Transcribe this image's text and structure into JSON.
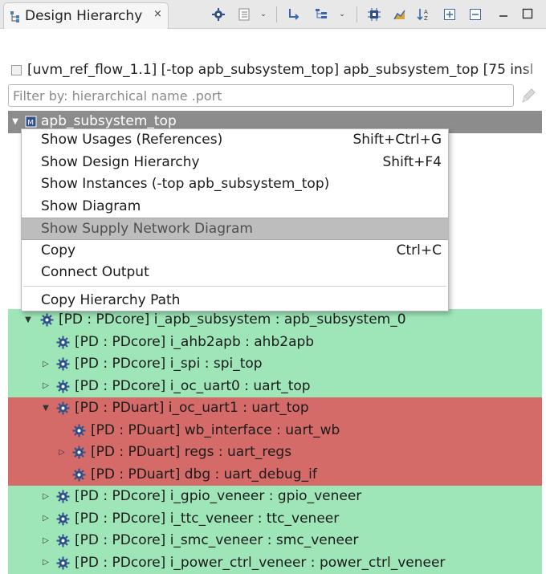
{
  "tab": {
    "title": "Design Hierarchy",
    "close_icon": "×"
  },
  "scope": {
    "text": "[uvm_ref_flow_1.1] [-top apb_subsystem_top] apb_subsystem_top [75 insl"
  },
  "filter": {
    "placeholder": "Filter by: hierarchical name .port",
    "value": ""
  },
  "tree": {
    "root": {
      "label": "apb_subsystem_top",
      "expanded": true,
      "selected": true
    },
    "rows": [
      {
        "label": "[PD : PDcore] i_apb_subsystem : apb_subsystem_0",
        "level": 1,
        "expander": "expanded",
        "color": "green"
      },
      {
        "label": "[PD : PDcore] i_ahb2apb : ahb2apb",
        "level": 2,
        "expander": "none",
        "color": "green"
      },
      {
        "label": "[PD : PDcore] i_spi : spi_top",
        "level": 2,
        "expander": "collapsed",
        "color": "green"
      },
      {
        "label": "[PD : PDcore] i_oc_uart0 : uart_top",
        "level": 2,
        "expander": "collapsed",
        "color": "green"
      },
      {
        "label": "[PD : PDuart] i_oc_uart1 : uart_top",
        "level": 2,
        "expander": "expanded",
        "color": "red"
      },
      {
        "label": "[PD : PDuart] wb_interface : uart_wb",
        "level": 3,
        "expander": "none",
        "color": "red"
      },
      {
        "label": "[PD : PDuart] regs : uart_regs",
        "level": 3,
        "expander": "collapsed",
        "color": "red"
      },
      {
        "label": "[PD : PDuart] dbg : uart_debug_if",
        "level": 3,
        "expander": "none",
        "color": "red"
      },
      {
        "label": "[PD : PDcore] i_gpio_veneer : gpio_veneer",
        "level": 2,
        "expander": "collapsed",
        "color": "green"
      },
      {
        "label": "[PD : PDcore] i_ttc_veneer : ttc_veneer",
        "level": 2,
        "expander": "collapsed",
        "color": "green"
      },
      {
        "label": "[PD : PDcore] i_smc_veneer : smc_veneer",
        "level": 2,
        "expander": "collapsed",
        "color": "green"
      },
      {
        "label": "[PD : PDcore] i_power_ctrl_veneer : power_ctrl_veneer",
        "level": 2,
        "expander": "collapsed",
        "color": "green"
      }
    ]
  },
  "context_menu": {
    "items": [
      {
        "label": "Show Usages (References)",
        "shortcut": "Shift+Ctrl+G"
      },
      {
        "label": "Show Design Hierarchy",
        "shortcut": "Shift+F4"
      },
      {
        "label": "Show Instances (-top apb_subsystem_top)",
        "shortcut": ""
      },
      {
        "label": "Show Diagram",
        "shortcut": ""
      },
      {
        "label": "Show Supply Network Diagram",
        "shortcut": "",
        "hovered": true
      },
      {
        "label": "Copy",
        "shortcut": "Ctrl+C"
      },
      {
        "label": "Connect Output",
        "shortcut": ""
      },
      {
        "label": "Copy Hierarchy Path",
        "shortcut": ""
      }
    ]
  },
  "colors": {
    "green_row": "#9ee6b8",
    "red_row": "#d46b69",
    "selected_row": "#8c8c8c",
    "menu_hover": "#bdbdbd"
  },
  "icons": {
    "tab": "hierarchy-icon",
    "instance": "gear-chip-icon",
    "root": "module-icon",
    "toolbar": [
      "settings-chip-icon",
      "list-icon",
      "dropdown-icon",
      "route-icon",
      "layout-icon",
      "dropdown-icon",
      "chip-icon",
      "chart-icon",
      "sort-az-icon",
      "expand-all-icon",
      "collapse-all-icon",
      "minimize-icon",
      "maximize-icon"
    ]
  }
}
